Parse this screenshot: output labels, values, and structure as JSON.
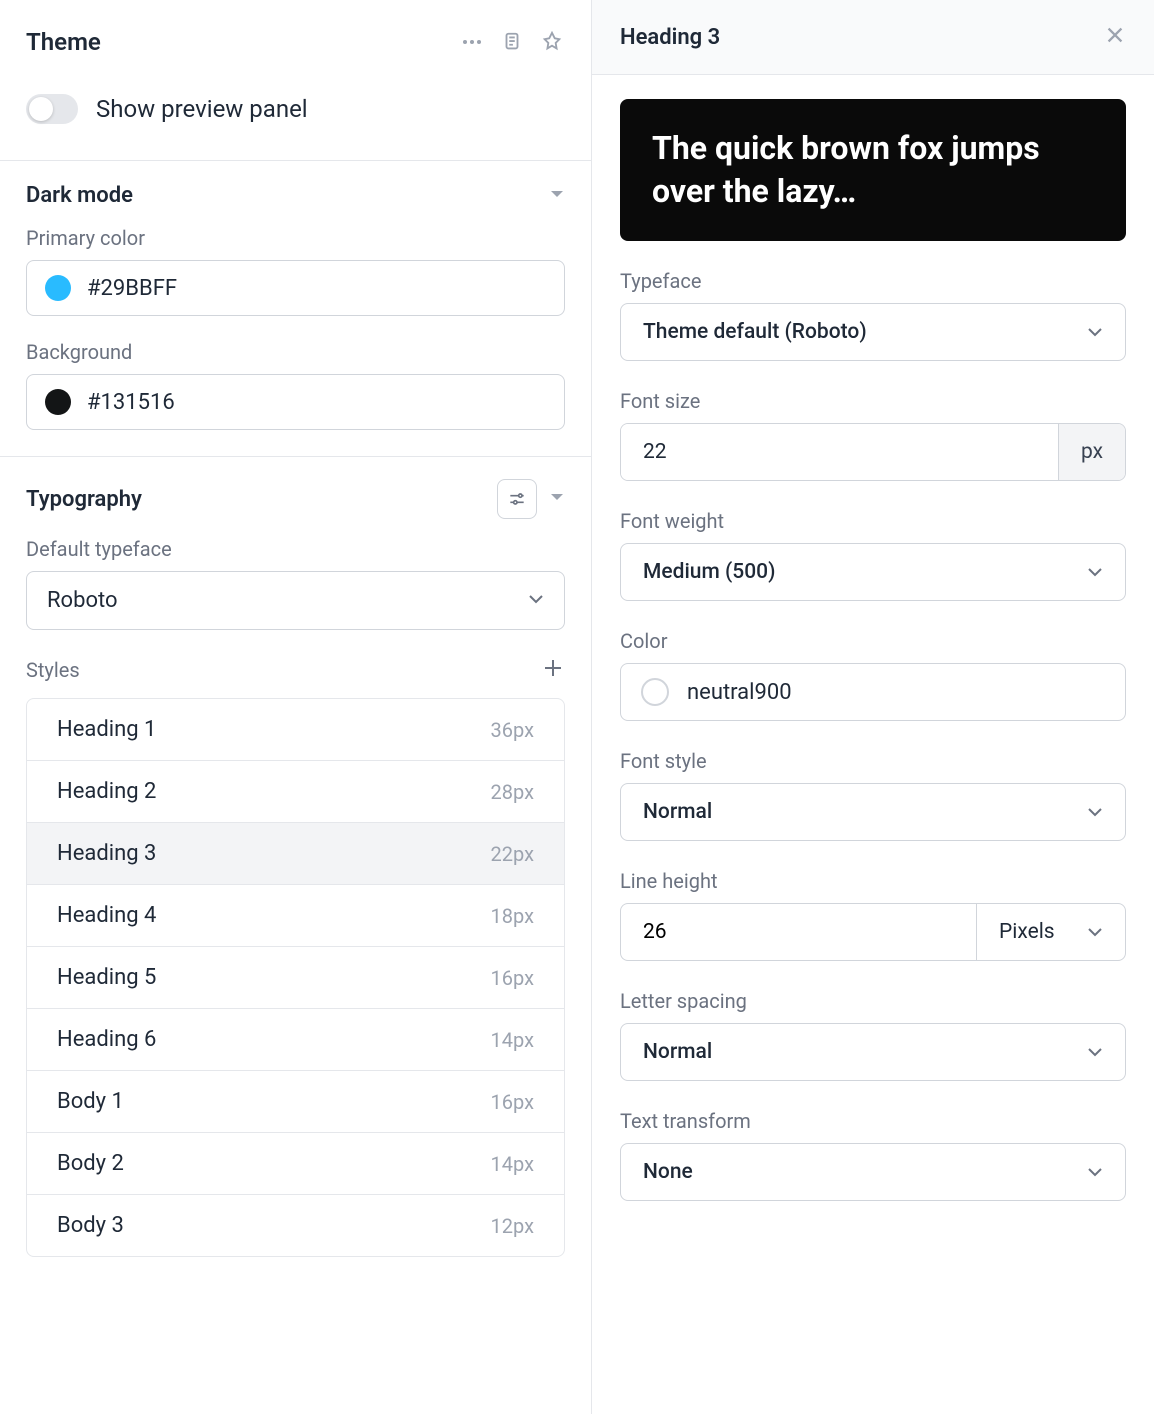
{
  "left": {
    "title": "Theme",
    "toggle_label": "Show preview panel",
    "dark_mode": {
      "title": "Dark mode",
      "primary_label": "Primary color",
      "primary_value": "#29BBFF",
      "background_label": "Background",
      "background_value": "#131516"
    },
    "typography": {
      "title": "Typography",
      "default_typeface_label": "Default typeface",
      "default_typeface_value": "Roboto",
      "styles_label": "Styles",
      "styles": [
        {
          "name": "Heading 1",
          "size": "36px",
          "selected": false
        },
        {
          "name": "Heading 2",
          "size": "28px",
          "selected": false
        },
        {
          "name": "Heading 3",
          "size": "22px",
          "selected": true
        },
        {
          "name": "Heading 4",
          "size": "18px",
          "selected": false
        },
        {
          "name": "Heading 5",
          "size": "16px",
          "selected": false
        },
        {
          "name": "Heading 6",
          "size": "14px",
          "selected": false
        },
        {
          "name": "Body 1",
          "size": "16px",
          "selected": false
        },
        {
          "name": "Body 2",
          "size": "14px",
          "selected": false
        },
        {
          "name": "Body 3",
          "size": "12px",
          "selected": false
        }
      ]
    }
  },
  "right": {
    "title": "Heading 3",
    "preview_text": "The quick brown fox jumps over the lazy…",
    "typeface": {
      "label": "Typeface",
      "value": "Theme default (Roboto)"
    },
    "font_size": {
      "label": "Font size",
      "value": "22",
      "unit": "px"
    },
    "font_weight": {
      "label": "Font weight",
      "value": "Medium (500)"
    },
    "color": {
      "label": "Color",
      "value": "neutral900"
    },
    "font_style": {
      "label": "Font style",
      "value": "Normal"
    },
    "line_height": {
      "label": "Line height",
      "value": "26",
      "unit": "Pixels"
    },
    "letter_spacing": {
      "label": "Letter spacing",
      "value": "Normal"
    },
    "text_transform": {
      "label": "Text transform",
      "value": "None"
    }
  }
}
